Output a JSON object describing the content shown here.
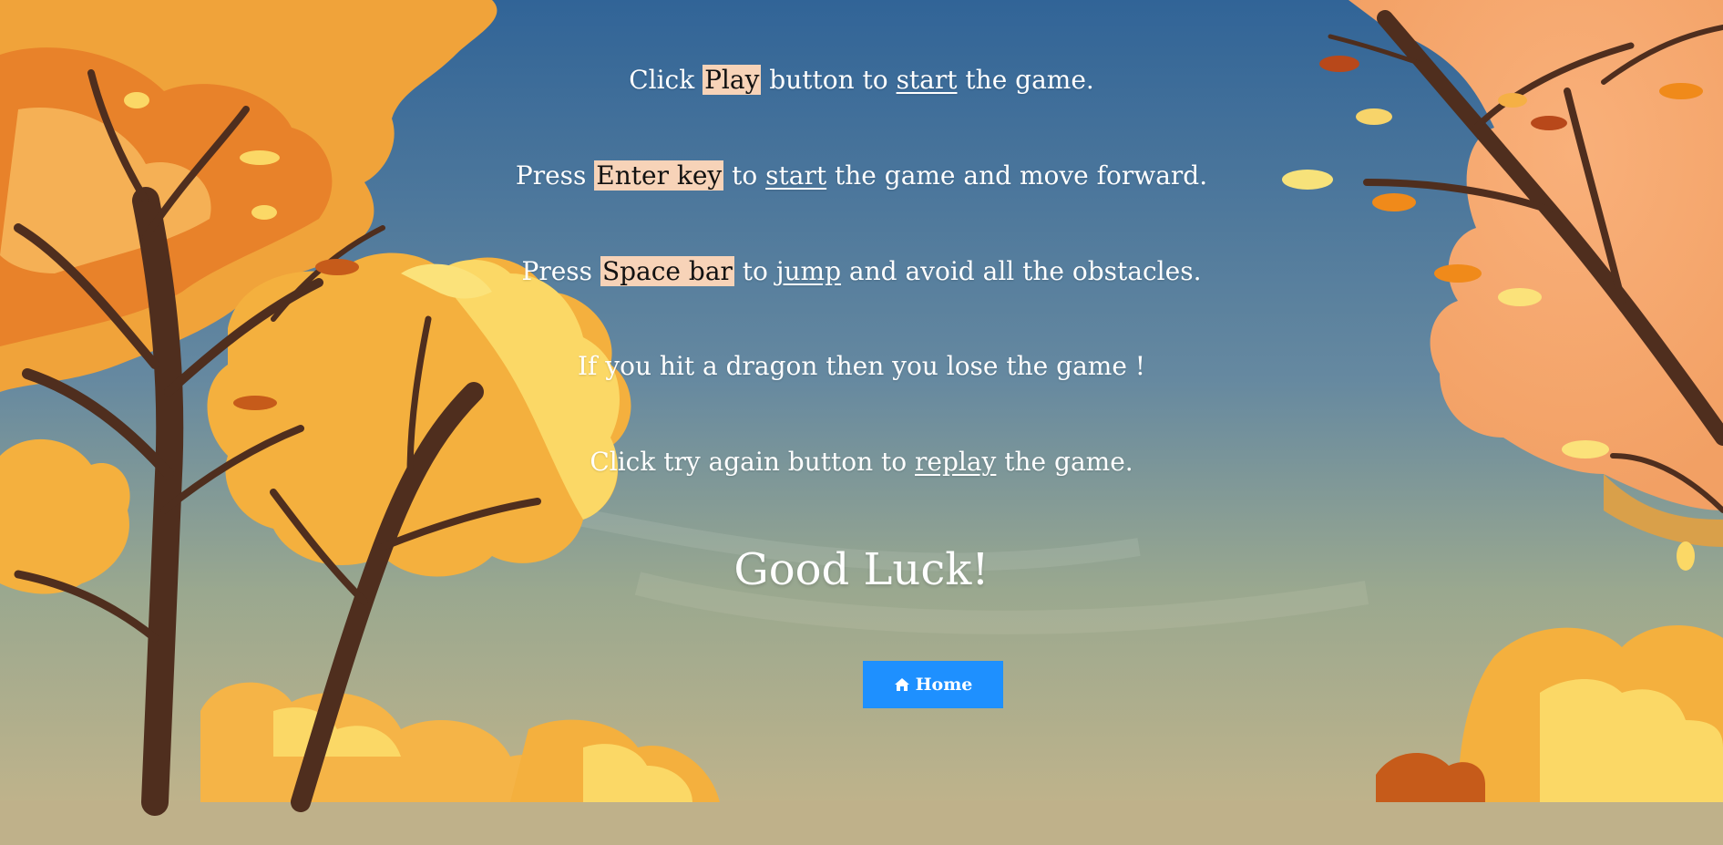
{
  "instructions": {
    "line1": {
      "part1": "Click ",
      "key": "Play",
      "part2": " button to ",
      "action": "start",
      "part3": " the game."
    },
    "line2": {
      "part1": "Press ",
      "key": "Enter key",
      "part2": " to ",
      "action": "start",
      "part3": " the game and move forward."
    },
    "line3": {
      "part1": "Press ",
      "key": "Space bar",
      "part2": " to ",
      "action": "jump",
      "part3": " and avoid all the obstacles."
    },
    "line4": {
      "text": "If you hit a dragon then you lose the game !"
    },
    "line5": {
      "part1": "Click try again button to ",
      "action": "replay",
      "part2": " the game."
    },
    "closing": "Good Luck!"
  },
  "home_button": {
    "icon": "home-icon",
    "label": "Home"
  },
  "colors": {
    "sky_top": "#316497",
    "sky_bottom": "#c6b58a",
    "ground": "#bfb18a",
    "highlight": "#f7d3b8",
    "button": "#1e90ff",
    "foliage": "#f4b03e",
    "trunk": "#4f2e1e"
  }
}
